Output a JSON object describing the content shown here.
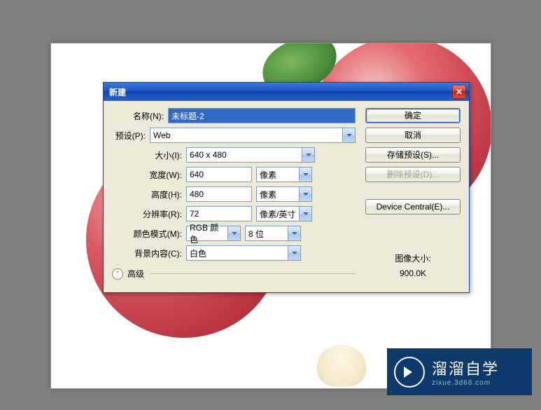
{
  "dialog": {
    "title": "新建",
    "labels": {
      "name": "名称(N):",
      "preset": "预设(P):",
      "size": "大小(I):",
      "width": "宽度(W):",
      "height": "高度(H):",
      "resolution": "分辨率(R):",
      "colormode": "颜色模式(M):",
      "background": "背景内容(C):",
      "advanced": "高级"
    },
    "values": {
      "name": "未标题-2",
      "preset": "Web",
      "size": "640 x 480",
      "width": "640",
      "height": "480",
      "resolution": "72",
      "colormode": "RGB 颜色",
      "bitdepth": "8 位",
      "background": "白色"
    },
    "units": {
      "width": "像素",
      "height": "像素",
      "resolution": "像素/英寸"
    },
    "buttons": {
      "ok": "确定",
      "cancel": "取消",
      "save_preset": "存储预设(S)...",
      "delete_preset": "删除预设(D)...",
      "device_central": "Device Central(E)..."
    },
    "info": {
      "size_label": "图像大小:",
      "size_value": "900.0K"
    }
  },
  "watermark": {
    "main": "溜溜自学",
    "sub": "zixue.3d66.com"
  }
}
